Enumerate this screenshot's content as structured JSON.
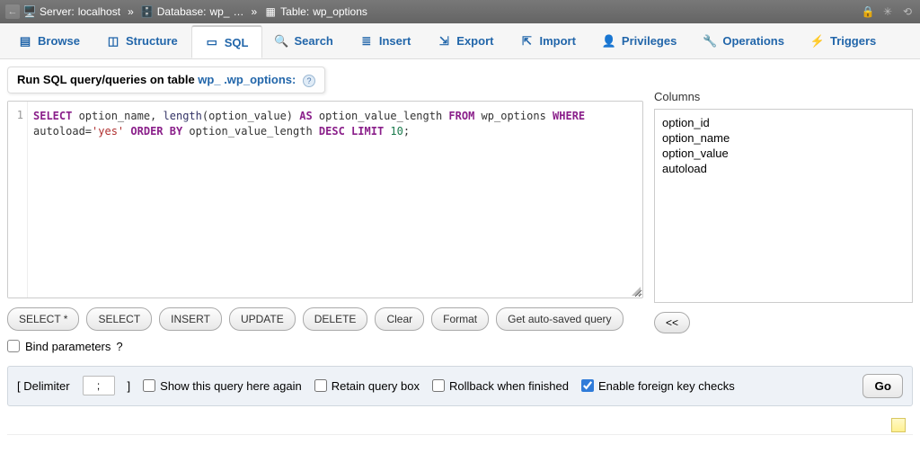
{
  "breadcrumb": {
    "server_label": "Server:",
    "server": "localhost",
    "db_label": "Database:",
    "db": "wp_",
    "table_label": "Table:",
    "table": "wp_options"
  },
  "tabs": [
    {
      "id": "browse",
      "label": "Browse"
    },
    {
      "id": "structure",
      "label": "Structure"
    },
    {
      "id": "sql",
      "label": "SQL"
    },
    {
      "id": "search",
      "label": "Search"
    },
    {
      "id": "insert",
      "label": "Insert"
    },
    {
      "id": "export",
      "label": "Export"
    },
    {
      "id": "import",
      "label": "Import"
    },
    {
      "id": "privileges",
      "label": "Privileges"
    },
    {
      "id": "operations",
      "label": "Operations"
    },
    {
      "id": "triggers",
      "label": "Triggers"
    }
  ],
  "active_tab": "sql",
  "query_header": {
    "prefix": "Run SQL query/queries on table ",
    "table": "wp_      .wp_options:"
  },
  "sql": {
    "line": "1",
    "tokens": {
      "select": "SELECT",
      "cols": " option_name, ",
      "len": "length",
      "lenarg": "(option_value) ",
      "as": "AS",
      "alias": " option_value_length ",
      "from": "FROM",
      "tbl": " wp_options ",
      "where": "WHERE",
      "cond_a": "autoload",
      "eq": "=",
      "str": "'yes'",
      "sp": " ",
      "order": "ORDER BY",
      "ocol": " option_value_length ",
      "desc": "DESC",
      "sp2": " ",
      "limit": "LIMIT",
      "sp3": " ",
      "num": "10",
      "semi": ";"
    }
  },
  "buttons": {
    "select_star": "SELECT *",
    "select": "SELECT",
    "insert": "INSERT",
    "update": "UPDATE",
    "delete": "DELETE",
    "clear": "Clear",
    "format": "Format",
    "autosave": "Get auto-saved query"
  },
  "bind_params": "Bind parameters",
  "columns_title": "Columns",
  "columns": [
    "option_id",
    "option_name",
    "option_value",
    "autoload"
  ],
  "arrow": "<<",
  "footer": {
    "delimiter_label": "Delimiter",
    "delimiter": ";",
    "show_again": "Show this query here again",
    "retain": "Retain query box",
    "rollback": "Rollback when finished",
    "fk": "Enable foreign key checks",
    "go": "Go"
  }
}
